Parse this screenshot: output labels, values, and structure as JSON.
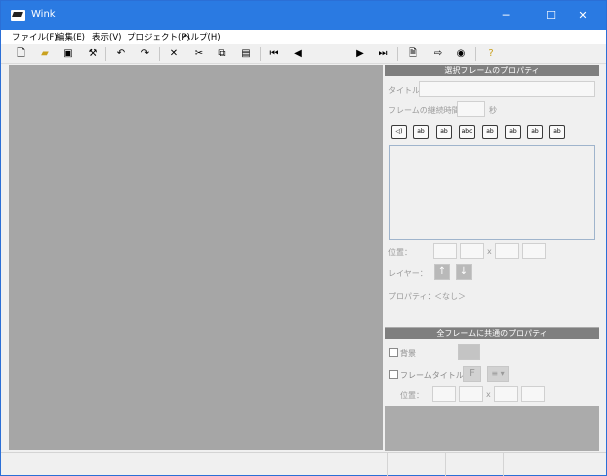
{
  "window": {
    "title": "Wink",
    "minimize": "─",
    "maximize": "☐",
    "close": "✕"
  },
  "menu": [
    "ファイル(F)",
    "編集(E)",
    "表示(V)",
    "プロジェクト(P)",
    "ヘルプ(H)"
  ],
  "toolbar": {
    "icons": [
      "new-icon",
      "open-icon",
      "save-icon",
      "render-icon",
      "undo-icon",
      "redo-icon",
      "delete-icon",
      "cut-icon",
      "copy-icon",
      "paste-icon",
      "first-frame-icon",
      "prev-frame-icon",
      "next-frame-icon",
      "last-frame-icon",
      "export-icon",
      "arrow-right-icon",
      "publish-icon",
      "help-icon"
    ]
  },
  "panel": {
    "selected_header": "選択フレームのプロパティ",
    "title_label": "タイトル",
    "duration_label": "フレームの継続時間",
    "duration_unit": "秒",
    "position_label": "位置：",
    "x_sep": "x",
    "layer_label": "レイヤー：",
    "layer_up": "↑",
    "layer_down": "↓",
    "property_label": "プロパティ：",
    "property_value": "＜なし＞",
    "common_header": "全フレームに共通のプロパティ",
    "background_label": "背景",
    "frame_title_label": "フレームタイトル",
    "position2_label": "位置：",
    "x_sep2": "x",
    "font_button": "F",
    "align_button": "≡ ▾"
  },
  "panel_tools": [
    "ab",
    "ab",
    "ab",
    "abc",
    "ab",
    "ab",
    "ab",
    "ab"
  ]
}
